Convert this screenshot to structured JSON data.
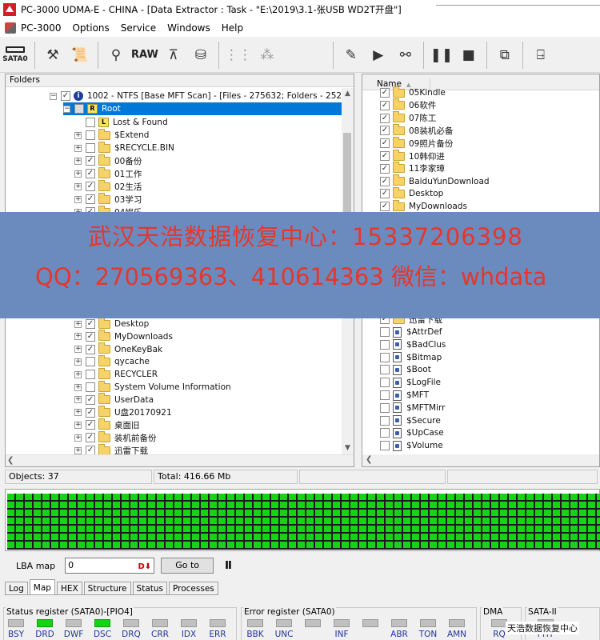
{
  "window": {
    "title": "PC-3000 UDMA-E - CHINA - [Data Extractor : Task - \"E:\\2019\\3.1-张USB WD2T开盘\"]"
  },
  "menu": [
    "PC-3000",
    "Options",
    "Service",
    "Windows",
    "Help"
  ],
  "toolbar": {
    "sata_label": "SATA0",
    "raw_label": "RAW"
  },
  "left_panel": {
    "header": "Folders",
    "volume_label": "1002 - NTFS [Base MFT Scan] - [Files - 275632; Folders - 25242]",
    "root_label": "Root",
    "root_tag": "R",
    "lost_tag": "L",
    "items_top": [
      "Lost & Found",
      "$Extend",
      "$RECYCLE.BIN",
      "00备份",
      "01工作",
      "02生活",
      "03学习",
      "04娱乐"
    ],
    "items_bottom": [
      "Desktop",
      "MyDownloads",
      "OneKeyBak",
      "qycache",
      "RECYCLER",
      "System Volume Information",
      "UserData",
      "U盘20170921",
      "桌面旧",
      "装机前备份",
      "迅雷下载"
    ]
  },
  "right_panel": {
    "column_name": "Name",
    "folders": [
      "05Kindle",
      "06软件",
      "07陈工",
      "08装机必备",
      "09照片备份",
      "10韩仰进",
      "11李家璋",
      "BaiduYunDownload",
      "Desktop",
      "MyDownloads"
    ],
    "partial_row": "迅雷下载",
    "files": [
      "$AttrDef",
      "$BadClus",
      "$Bitmap",
      "$Boot",
      "$LogFile",
      "$MFT",
      "$MFTMirr",
      "$Secure",
      "$UpCase",
      "$Volume"
    ]
  },
  "banner": {
    "line1": "武汉天浩数据恢复中心：15337206398",
    "line2": "QQ：270569363、410614363   微信：whdata",
    "background": "#6b8bbf",
    "text_color": "#e4372b"
  },
  "status": {
    "objects": "Objects: 37",
    "total": "Total: 416.66 Mb"
  },
  "lba": {
    "label": "LBA map",
    "value": "0",
    "go_label": "Go to",
    "pause_label": "II"
  },
  "tabs": [
    "Log",
    "Map",
    "HEX",
    "Structure",
    "Status",
    "Processes"
  ],
  "status_register": {
    "title": "Status register (SATA0)-[PIO4]",
    "leds": [
      {
        "name": "BSY",
        "on": false
      },
      {
        "name": "DRD",
        "on": true
      },
      {
        "name": "DWF",
        "on": false
      },
      {
        "name": "DSC",
        "on": true
      },
      {
        "name": "DRQ",
        "on": false
      },
      {
        "name": "CRR",
        "on": false
      },
      {
        "name": "IDX",
        "on": false
      },
      {
        "name": "ERR",
        "on": false
      }
    ]
  },
  "error_register": {
    "title": "Error register (SATA0)",
    "leds": [
      {
        "name": "BBK",
        "on": false
      },
      {
        "name": "UNC",
        "on": false
      },
      {
        "name": "",
        "on": false
      },
      {
        "name": "INF",
        "on": false
      },
      {
        "name": "",
        "on": false
      },
      {
        "name": "ABR",
        "on": false
      },
      {
        "name": "TON",
        "on": false
      },
      {
        "name": "AMN",
        "on": false
      }
    ]
  },
  "dma": {
    "title": "DMA",
    "led_label": "RQ"
  },
  "sata2": {
    "title": "SATA-II",
    "led_label": "PHY"
  },
  "watermark": "天浩数据恢复中心"
}
